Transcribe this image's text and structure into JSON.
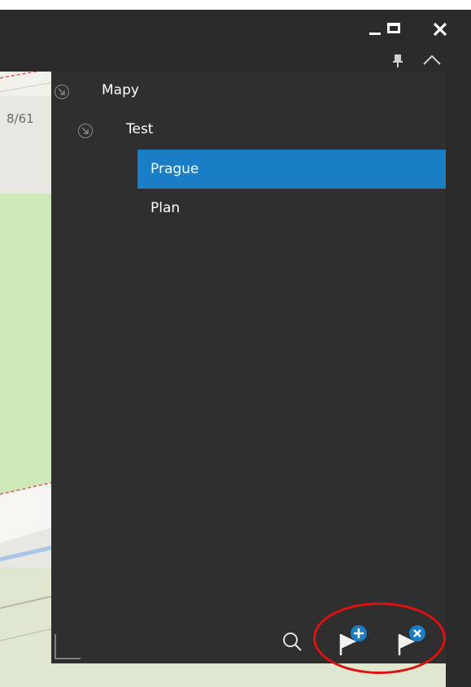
{
  "window": {
    "minimize_icon": "minimize-icon",
    "maximize_icon": "maximize-icon",
    "close_icon": "close-icon",
    "pin_icon": "pin-icon",
    "collapse_icon": "chevron-up-icon"
  },
  "map": {
    "scale_label": "8/61"
  },
  "tree": {
    "root": {
      "label": "Mapy"
    },
    "group": {
      "label": "Test"
    },
    "items": [
      {
        "label": "Prague",
        "selected": true
      },
      {
        "label": "Plan",
        "selected": false
      }
    ]
  },
  "toolbar": {
    "search_icon": "search-icon",
    "add_flag_icon": "flag-add-icon",
    "remove_flag_icon": "flag-remove-icon"
  },
  "colors": {
    "panel_bg": "#2f2f2f",
    "selection": "#1a7ec7",
    "badge": "#1a7ec7",
    "annotation": "#e01010"
  }
}
